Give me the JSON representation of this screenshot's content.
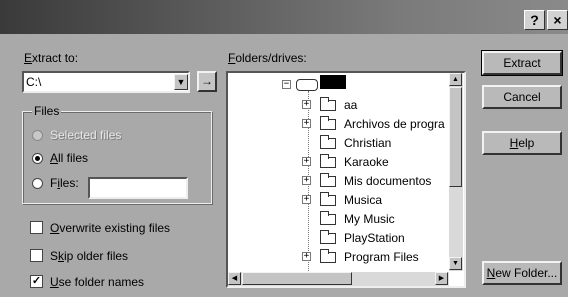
{
  "title_buttons": {
    "help": "?",
    "close": "×"
  },
  "extract_to": {
    "label_accel": "E",
    "label_rest": "xtract to:",
    "path": "C:\\",
    "browse_glyph": "→"
  },
  "folders": {
    "label_accel": "F",
    "label_rest": "olders/drives:",
    "items": [
      {
        "label": "aa",
        "expander": "+"
      },
      {
        "label": "Archivos de progra",
        "expander": "+"
      },
      {
        "label": "Christian",
        "expander": ""
      },
      {
        "label": "Karaoke",
        "expander": "+"
      },
      {
        "label": "Mis documentos",
        "expander": "+"
      },
      {
        "label": "Musica",
        "expander": "+"
      },
      {
        "label": "My Music",
        "expander": ""
      },
      {
        "label": "PlayStation",
        "expander": ""
      },
      {
        "label": "Program Files",
        "expander": "+"
      }
    ],
    "root_expander": "−"
  },
  "files_group": {
    "title": "Files",
    "selected_files": "Selected files",
    "all_files_accel": "A",
    "all_files_rest": "ll files",
    "files_accel": "i",
    "files_pre": "F",
    "files_post": "les:",
    "files_value": ""
  },
  "options": {
    "overwrite_accel": "O",
    "overwrite_rest": "verwrite existing files",
    "overwrite_checked": "",
    "skip_accel": "k",
    "skip_pre": "S",
    "skip_post": "ip older files",
    "skip_checked": "",
    "use_accel": "U",
    "use_rest": "se folder names",
    "use_checked": "✓"
  },
  "buttons": {
    "extract": "Extract",
    "cancel": "Cancel",
    "help_accel": "H",
    "help_rest": "elp",
    "newfolder_accel": "N",
    "newfolder_rest": "ew Folder..."
  }
}
